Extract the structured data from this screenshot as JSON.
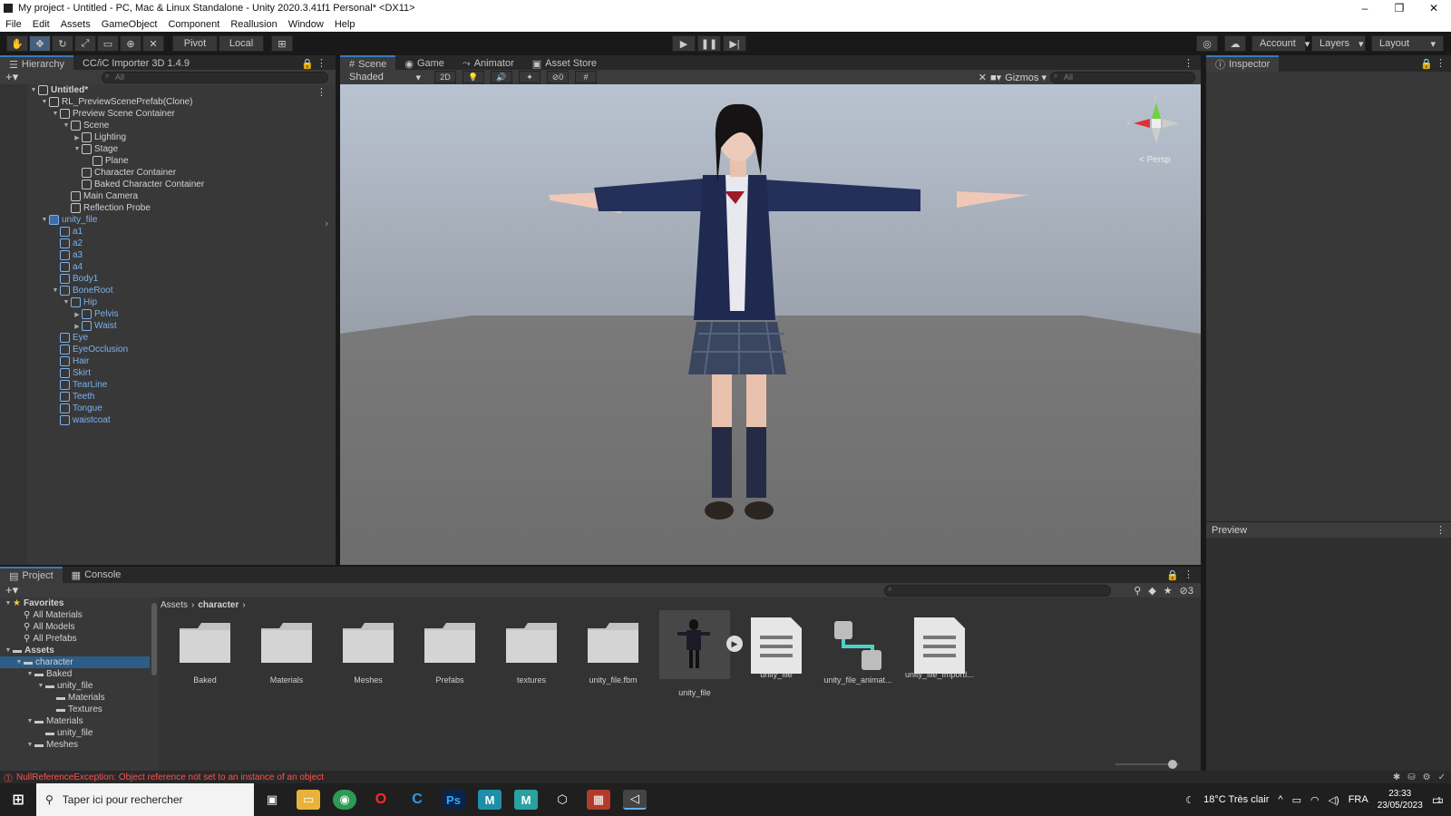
{
  "window": {
    "title": "My project - Untitled - PC, Mac & Linux Standalone - Unity 2020.3.41f1 Personal* <DX11>"
  },
  "menu": [
    "File",
    "Edit",
    "Assets",
    "GameObject",
    "Component",
    "Reallusion",
    "Window",
    "Help"
  ],
  "toolbar": {
    "pivot": "Pivot",
    "local": "Local",
    "account": "Account",
    "layers": "Layers",
    "layout": "Layout"
  },
  "hierarchy": {
    "tab": "Hierarchy",
    "tab2": "CC/iC Importer 3D 1.4.9",
    "search_placeholder": "All",
    "rows": [
      {
        "label": "Untitled*",
        "depth": 0,
        "arrow": "▼",
        "color": "bold"
      },
      {
        "label": "RL_PreviewScenePrefab(Clone)",
        "depth": 1,
        "arrow": "▼",
        "color": "white"
      },
      {
        "label": "Preview Scene Container",
        "depth": 2,
        "arrow": "▼",
        "color": "white"
      },
      {
        "label": "Scene",
        "depth": 3,
        "arrow": "▼",
        "color": "white"
      },
      {
        "label": "Lighting",
        "depth": 4,
        "arrow": "▶",
        "color": "white"
      },
      {
        "label": "Stage",
        "depth": 4,
        "arrow": "▼",
        "color": "white"
      },
      {
        "label": "Plane",
        "depth": 5,
        "arrow": "",
        "color": "white"
      },
      {
        "label": "Character Container",
        "depth": 4,
        "arrow": "",
        "color": "white"
      },
      {
        "label": "Baked Character Container",
        "depth": 4,
        "arrow": "",
        "color": "white"
      },
      {
        "label": "Main Camera",
        "depth": 3,
        "arrow": "",
        "color": "white"
      },
      {
        "label": "Reflection Probe",
        "depth": 3,
        "arrow": "",
        "color": "white"
      },
      {
        "label": "unity_file",
        "depth": 1,
        "arrow": "▼",
        "color": "blue"
      },
      {
        "label": "a1",
        "depth": 2,
        "arrow": "",
        "color": "blue"
      },
      {
        "label": "a2",
        "depth": 2,
        "arrow": "",
        "color": "blue"
      },
      {
        "label": "a3",
        "depth": 2,
        "arrow": "",
        "color": "blue"
      },
      {
        "label": "a4",
        "depth": 2,
        "arrow": "",
        "color": "blue"
      },
      {
        "label": "Body1",
        "depth": 2,
        "arrow": "",
        "color": "blue"
      },
      {
        "label": "BoneRoot",
        "depth": 2,
        "arrow": "▼",
        "color": "blue"
      },
      {
        "label": "Hip",
        "depth": 3,
        "arrow": "▼",
        "color": "blue"
      },
      {
        "label": "Pelvis",
        "depth": 4,
        "arrow": "▶",
        "color": "blue"
      },
      {
        "label": "Waist",
        "depth": 4,
        "arrow": "▶",
        "color": "blue"
      },
      {
        "label": "Eye",
        "depth": 2,
        "arrow": "",
        "color": "blue"
      },
      {
        "label": "EyeOcclusion",
        "depth": 2,
        "arrow": "",
        "color": "blue"
      },
      {
        "label": "Hair",
        "depth": 2,
        "arrow": "",
        "color": "blue"
      },
      {
        "label": "Skirt",
        "depth": 2,
        "arrow": "",
        "color": "blue"
      },
      {
        "label": "TearLine",
        "depth": 2,
        "arrow": "",
        "color": "blue"
      },
      {
        "label": "Teeth",
        "depth": 2,
        "arrow": "",
        "color": "blue"
      },
      {
        "label": "Tongue",
        "depth": 2,
        "arrow": "",
        "color": "blue"
      },
      {
        "label": "waistcoat",
        "depth": 2,
        "arrow": "",
        "color": "blue"
      }
    ]
  },
  "scene": {
    "tabs": [
      "Scene",
      "Game",
      "Animator",
      "Asset Store"
    ],
    "shading": "Shaded",
    "mode2d": "2D",
    "hidden_count": "0",
    "gizmos": "Gizmos",
    "search_placeholder": "All",
    "persp": "< Persp",
    "axis_y": "y",
    "axis_x": "x"
  },
  "inspector": {
    "tab": "Inspector",
    "preview": "Preview"
  },
  "project": {
    "tabs": [
      "Project",
      "Console"
    ],
    "badge": "3",
    "breadcrumb": [
      "Assets",
      "character"
    ],
    "tree": [
      {
        "label": "Favorites",
        "depth": 0,
        "arrow": "▼",
        "icon": "star",
        "bold": true
      },
      {
        "label": "All Materials",
        "depth": 1,
        "arrow": "",
        "icon": "search",
        "bold": false
      },
      {
        "label": "All Models",
        "depth": 1,
        "arrow": "",
        "icon": "search",
        "bold": false
      },
      {
        "label": "All Prefabs",
        "depth": 1,
        "arrow": "",
        "icon": "search",
        "bold": false
      },
      {
        "label": "Assets",
        "depth": 0,
        "arrow": "▼",
        "icon": "folder",
        "bold": true
      },
      {
        "label": "character",
        "depth": 1,
        "arrow": "▼",
        "icon": "folder",
        "bold": false,
        "selected": true
      },
      {
        "label": "Baked",
        "depth": 2,
        "arrow": "▼",
        "icon": "folder",
        "bold": false
      },
      {
        "label": "unity_file",
        "depth": 3,
        "arrow": "▼",
        "icon": "folder",
        "bold": false
      },
      {
        "label": "Materials",
        "depth": 4,
        "arrow": "",
        "icon": "folder",
        "bold": false
      },
      {
        "label": "Textures",
        "depth": 4,
        "arrow": "",
        "icon": "folder",
        "bold": false
      },
      {
        "label": "Materials",
        "depth": 2,
        "arrow": "▼",
        "icon": "folder",
        "bold": false
      },
      {
        "label": "unity_file",
        "depth": 3,
        "arrow": "",
        "icon": "folder",
        "bold": false
      },
      {
        "label": "Meshes",
        "depth": 2,
        "arrow": "▼",
        "icon": "folder",
        "bold": false
      }
    ],
    "assets": [
      {
        "label": "Baked",
        "kind": "folder"
      },
      {
        "label": "Materials",
        "kind": "folder"
      },
      {
        "label": "Meshes",
        "kind": "folder"
      },
      {
        "label": "Prefabs",
        "kind": "folder"
      },
      {
        "label": "textures",
        "kind": "folder"
      },
      {
        "label": "unity_file.fbm",
        "kind": "folder"
      },
      {
        "label": "unity_file",
        "kind": "model"
      },
      {
        "label": "unity_file",
        "kind": "doc"
      },
      {
        "label": "unity_file_animat...",
        "kind": "anim"
      },
      {
        "label": "unity_file_ImportI...",
        "kind": "doc"
      }
    ]
  },
  "status": {
    "message": "NullReferenceException: Object reference not set to an instance of an object"
  },
  "taskbar": {
    "search_placeholder": "Taper ici pour rechercher",
    "weather": "18°C  Très clair",
    "lang": "FRA",
    "time": "23:33",
    "date": "23/05/2023",
    "notifications": "1"
  }
}
